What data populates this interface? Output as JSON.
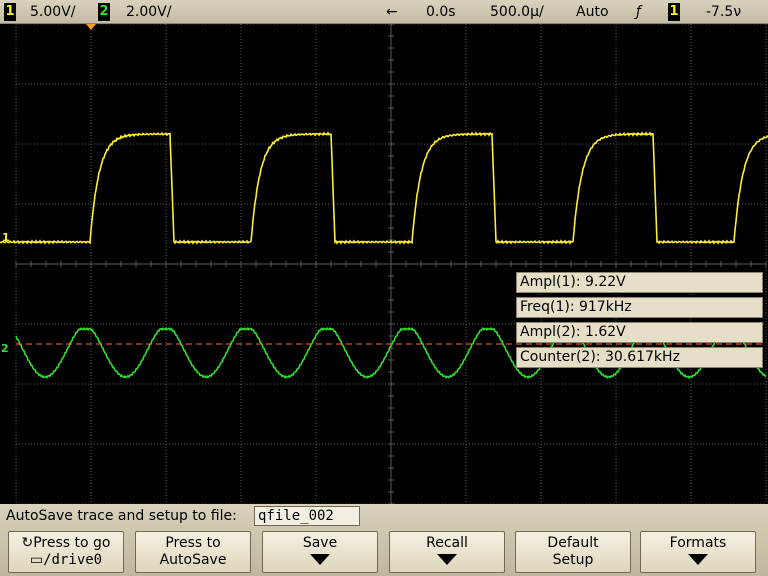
{
  "statusbar": {
    "ch1_label": "1",
    "ch1_scale": "5.00V/",
    "ch2_label": "2",
    "ch2_scale": "2.00V/",
    "delay_arrow": "←",
    "delay": "0.0s",
    "timebase": "500.0µ/",
    "trigger_mode": "Auto",
    "trigger_edge": "ƒ",
    "trigger_source": "1",
    "trigger_level": "-7.5ν"
  },
  "measurements": [
    "Ampl(1): 9.22V",
    "Freq(1): 917kHz",
    "Ampl(2): 1.62V",
    "Counter(2): 30.617kHz"
  ],
  "markers": {
    "ch1": "1",
    "ch2": "2"
  },
  "autosave": {
    "label": "AutoSave trace and setup to file:",
    "filename": "qfile_002"
  },
  "softkeys": {
    "press_to_go_line1": "Press to go",
    "press_to_go_line2": "/drive0",
    "press_to_autosave_line1": "Press to",
    "press_to_autosave_line2": "AutoSave",
    "save": "Save",
    "recall": "Recall",
    "default_setup_line1": "Default",
    "default_setup_line2": "Setup",
    "formats": "Formats"
  },
  "colors": {
    "ch1": "#ffee33",
    "ch2": "#33dd33",
    "trigger_level_line": "#ff6a2a",
    "grid": "#5a5a5a"
  }
}
